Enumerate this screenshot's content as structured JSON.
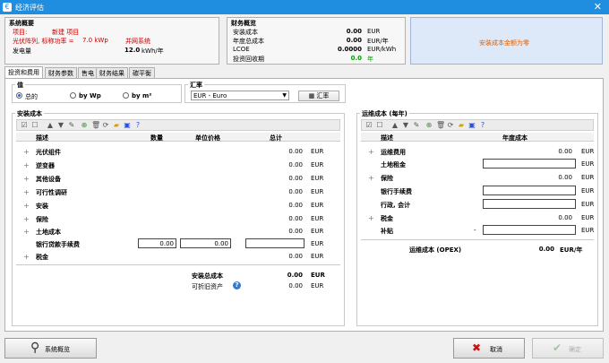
{
  "window": {
    "title": "经济评估"
  },
  "summary": {
    "heading": "系统概要",
    "project_label": "项目:",
    "project_value": "新建 项目",
    "pv_power_label": "光伏阵列, 标称功率 =",
    "pv_power_value": "7.0 kWp",
    "grid_system": "并网系统",
    "generation_label": "发电量",
    "generation_value": "12.0",
    "generation_unit": "kWh/年"
  },
  "finance": {
    "heading": "财务概览",
    "rows": [
      {
        "label": "安装成本",
        "value": "0.00",
        "unit": "EUR"
      },
      {
        "label": "年度总成本",
        "value": "0.00",
        "unit": "EUR/年"
      },
      {
        "label": "LCOE",
        "value": "0.0000",
        "unit": "EUR/kWh"
      },
      {
        "label": "投资回收期",
        "value": "0.0",
        "unit": "年"
      }
    ]
  },
  "warning": {
    "text": "安装成本金额为零"
  },
  "tabs": [
    "投资和费用",
    "财务参数",
    "售电",
    "财务结果",
    "碳平衡"
  ],
  "value_group": {
    "title": "值",
    "options": [
      "总的",
      "by Wp",
      "by m²"
    ]
  },
  "currency_group": {
    "title": "汇率",
    "selected": "EUR - Euro",
    "button_label": "汇率"
  },
  "install_costs": {
    "title": "安装成本",
    "headers": {
      "desc": "描述",
      "qty": "数量",
      "unit_price": "单位价格",
      "total": "总计"
    },
    "rows": [
      {
        "label": "光伏组件",
        "value": "0.00",
        "unit": "EUR",
        "expand": "+"
      },
      {
        "label": "逆变器",
        "value": "0.00",
        "unit": "EUR",
        "expand": "+"
      },
      {
        "label": "其他设备",
        "value": "0.00",
        "unit": "EUR",
        "expand": "+"
      },
      {
        "label": "可行性调研",
        "value": "0.00",
        "unit": "EUR",
        "expand": "+"
      },
      {
        "label": "安装",
        "value": "0.00",
        "unit": "EUR",
        "expand": "+"
      },
      {
        "label": "保险",
        "value": "0.00",
        "unit": "EUR",
        "expand": "+"
      },
      {
        "label": "土地成本",
        "value": "0.00",
        "unit": "EUR",
        "expand": "+"
      },
      {
        "label": "银行贷款手续费",
        "qty": "0.00",
        "price": "0.00",
        "value": "",
        "unit": "EUR",
        "expand": ""
      },
      {
        "label": "税金",
        "value": "0.00",
        "unit": "EUR",
        "expand": "+"
      }
    ],
    "total_label": "安装总成本",
    "total_value": "0.00",
    "total_unit": "EUR",
    "depreciable_label": "可折旧资产",
    "depreciable_value": "0.00",
    "depreciable_unit": "EUR"
  },
  "opex": {
    "title": "运维成本 (每年)",
    "headers": {
      "desc": "描述",
      "annual": "年度成本"
    },
    "rows": [
      {
        "label": "运维费用",
        "value": "0.00",
        "unit": "EUR",
        "expand": "+",
        "input": false
      },
      {
        "label": "土地租金",
        "value": "",
        "unit": "EUR",
        "expand": "",
        "input": true
      },
      {
        "label": "保险",
        "value": "0.00",
        "unit": "EUR",
        "expand": "+",
        "input": false
      },
      {
        "label": "银行手续费",
        "value": "",
        "unit": "EUR",
        "expand": "",
        "input": true
      },
      {
        "label": "行政, 会计",
        "value": "",
        "unit": "EUR",
        "expand": "",
        "input": true
      },
      {
        "label": "税金",
        "value": "0.00",
        "unit": "EUR",
        "expand": "+",
        "input": false
      },
      {
        "label": "补贴",
        "prefix": "-",
        "value": "",
        "unit": "EUR",
        "expand": "",
        "input": true
      }
    ],
    "total_label": "运维成本 (OPEX)",
    "total_value": "0.00",
    "total_unit": "EUR/年"
  },
  "buttons": {
    "overview": "系统概览",
    "cancel": "取消",
    "ok": "确定"
  }
}
